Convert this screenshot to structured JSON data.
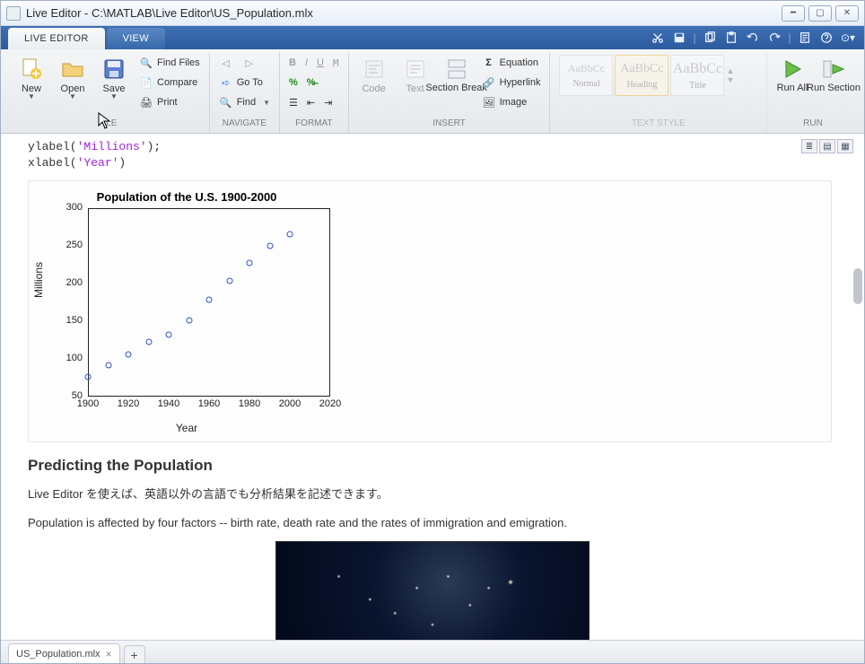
{
  "window": {
    "title": "Live Editor - C:\\MATLAB\\Live Editor\\US_Population.mlx"
  },
  "tabs": {
    "live_editor": "LIVE EDITOR",
    "view": "VIEW"
  },
  "ribbon": {
    "file": {
      "label": "FILE",
      "new": "New",
      "open": "Open",
      "save": "Save",
      "find_files": "Find Files",
      "compare": "Compare",
      "print": "Print"
    },
    "navigate": {
      "label": "NAVIGATE",
      "goto": "Go To",
      "find": "Find"
    },
    "format": {
      "label": "FORMAT"
    },
    "insert": {
      "label": "INSERT",
      "code": "Code",
      "text": "Text",
      "section_break": "Section\nBreak",
      "equation": "Equation",
      "hyperlink": "Hyperlink",
      "image": "Image"
    },
    "text_style": {
      "label": "TEXT STYLE",
      "normal": "Normal",
      "heading": "Heading",
      "title": "Title",
      "sample": "AaBbCc"
    },
    "run": {
      "label": "RUN",
      "run_all": "Run\nAll",
      "run_section": "Run\nSection"
    }
  },
  "code": {
    "line1a": "ylabel(",
    "line1b": "'Millions'",
    "line1c": ");",
    "line2a": "xlabel(",
    "line2b": "'Year'",
    "line2c": ")"
  },
  "chart_data": {
    "type": "scatter",
    "title": "Population of the U.S. 1900-2000",
    "xlabel": "Year",
    "ylabel": "Millions",
    "x": [
      1900,
      1910,
      1920,
      1930,
      1940,
      1950,
      1960,
      1970,
      1980,
      1990,
      2000
    ],
    "values": [
      76,
      92,
      106,
      123,
      132,
      151,
      179,
      203,
      227,
      250,
      265
    ],
    "xlim": [
      1900,
      2020
    ],
    "ylim": [
      50,
      300
    ],
    "xticks": [
      1900,
      1920,
      1940,
      1960,
      1980,
      2000,
      2020
    ],
    "yticks": [
      50,
      100,
      150,
      200,
      250,
      300
    ]
  },
  "doc": {
    "heading": "Predicting the Population",
    "p1": "Live Editor を使えば、英語以外の言語でも分析結果を記述できます。",
    "p2": "Population is affected by four factors -- birth rate, death rate and the rates of immigration and emigration."
  },
  "tabs_bottom": {
    "file": "US_Population.mlx"
  }
}
